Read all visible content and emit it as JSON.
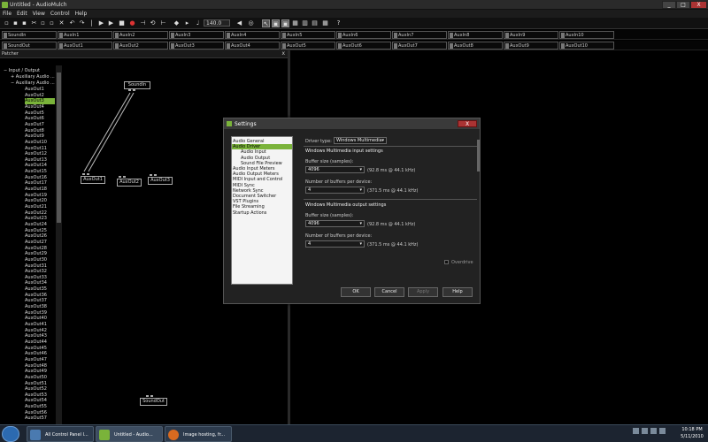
{
  "window": {
    "title": "Untitled - AudioMulch",
    "minimize": "_",
    "maximize": "□",
    "close": "X"
  },
  "menu": [
    "File",
    "Edit",
    "View",
    "Control",
    "Help"
  ],
  "toolbar": {
    "tempo": "140.0"
  },
  "meters_in": [
    "SoundIn",
    "AuxIn1",
    "AuxIn2",
    "AuxIn3",
    "AuxIn4",
    "AuxIn5",
    "AuxIn6",
    "AuxIn7",
    "AuxIn8",
    "AuxIn9",
    "AuxIn10"
  ],
  "meters_out": [
    "SoundOut",
    "AuxOut1",
    "AuxOut2",
    "AuxOut3",
    "AuxOut4",
    "AuxOut5",
    "AuxOut6",
    "AuxOut7",
    "AuxOut8",
    "AuxOut9",
    "AuxOut10"
  ],
  "patcher": {
    "title": "Patcher",
    "close": "x",
    "tree_parents": [
      "Input / Output",
      "Auxiliary Audio ...",
      "Auxiliary Audio ..."
    ],
    "tree_items": [
      "AuxOut1",
      "AuxOut2",
      "AuxOut3",
      "AuxOut4",
      "AuxOut5",
      "AuxOut6",
      "AuxOut7",
      "AuxOut8",
      "AuxOut9",
      "AuxOut10",
      "AuxOut11",
      "AuxOut12",
      "AuxOut13",
      "AuxOut14",
      "AuxOut15",
      "AuxOut16",
      "AuxOut17",
      "AuxOut18",
      "AuxOut19",
      "AuxOut20",
      "AuxOut21",
      "AuxOut22",
      "AuxOut23",
      "AuxOut24",
      "AuxOut25",
      "AuxOut26",
      "AuxOut27",
      "AuxOut28",
      "AuxOut29",
      "AuxOut30",
      "AuxOut31",
      "AuxOut32",
      "AuxOut33",
      "AuxOut34",
      "AuxOut35",
      "AuxOut36",
      "AuxOut37",
      "AuxOut38",
      "AuxOut39",
      "AuxOut40",
      "AuxOut41",
      "AuxOut42",
      "AuxOut43",
      "AuxOut44",
      "AuxOut45",
      "AuxOut46",
      "AuxOut47",
      "AuxOut48",
      "AuxOut49",
      "AuxOut50",
      "AuxOut51",
      "AuxOut52",
      "AuxOut53",
      "AuxOut54",
      "AuxOut55",
      "AuxOut56",
      "AuxOut57"
    ],
    "selected_item": "AuxOut3",
    "modules": {
      "soundin": "SoundIn",
      "auxout1": "AuxOut1",
      "auxout2": "AuxOut2",
      "auxout3": "AuxOut3",
      "soundout": "SoundOut"
    }
  },
  "settings": {
    "title": "Settings",
    "close": "X",
    "nav": [
      "Audio General",
      "Audio Driver",
      "Audio Input",
      "Audio Output",
      "Sound File Preview",
      "Audio Input Meters",
      "Audio Output Meters",
      "MIDI Input and Control",
      "MIDI Sync",
      "Network Sync",
      "Document Switcher",
      "VST Plugins",
      "File Streaming",
      "Startup Actions"
    ],
    "selected_nav": "Audio Driver",
    "driver_type_label": "Driver type:",
    "driver_type_value": "Windows Multimedia",
    "input_section": "Windows Multimedia input settings",
    "output_section": "Windows Multimedia output settings",
    "buffer_size_label": "Buffer size (samples):",
    "buffer_count_label": "Number of buffers per device:",
    "input_buffer_size": "4096",
    "input_buffer_size_info": "(92.8 ms @ 44.1 kHz)",
    "input_buffers": "4",
    "input_buffers_info": "(371.5 ms @ 44.1 kHz)",
    "output_buffer_size": "4096",
    "output_buffer_size_info": "(92.8 ms @ 44.1 kHz)",
    "output_buffers": "4",
    "output_buffers_info": "(371.5 ms @ 44.1 kHz)",
    "overdrive_label": "Overdrive",
    "buttons": {
      "ok": "OK",
      "cancel": "Cancel",
      "apply": "Apply",
      "help": "Help"
    }
  },
  "taskbar": {
    "tasks": [
      "All Control Panel I...",
      "Untitled - Audio...",
      "Image hosting, fr..."
    ],
    "time": "10:18 PM",
    "date": "5/11/2010"
  }
}
